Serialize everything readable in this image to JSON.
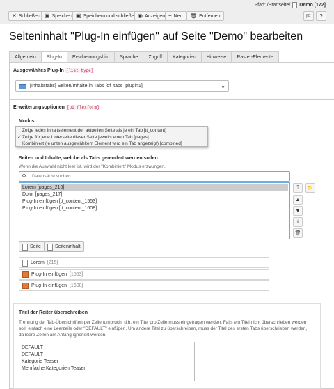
{
  "toolbar": {
    "close_label": "Schließen",
    "save_label": "Speichern",
    "save_close_label": "Speichern und schließen",
    "view_label": "Anzeigen",
    "new_label": "Neu",
    "delete_label": "Entfernen"
  },
  "path": {
    "prefix": "Pfad: /Startseite/",
    "page": "Demo [172]"
  },
  "page_title": "Seiteninhalt \"Plug-In einfügen\" auf Seite \"Demo\" bearbeiten",
  "tabs": [
    "Allgemein",
    "Plug-In",
    "Erscheinungsbild",
    "Sprache",
    "Zugriff",
    "Kategorien",
    "Hinweise",
    "Raster-Elemente"
  ],
  "active_tab": "Plug-In",
  "plugin": {
    "label": "Ausgewähltes Plug-In",
    "code": "[list_type]",
    "value": "[Inhaltstabs] Seiten/Inhalte in Tabs [df_tabs_plugin1]"
  },
  "options": {
    "label": "Erweiterungsoptionen",
    "code": "[pi_flexform]"
  },
  "modus": {
    "label": "Modus",
    "options": [
      "Zeige jedes Inhaltselement der aktuellen Seite als je ein Tab [tt_content]",
      "Zeige für jede Unterseite dieser Seite jeweils einen Tab [pages]",
      "Kombiniert (je unten ausgewähltem Element wird ein Tab angezeigt) [combined]"
    ],
    "checked_index": 1,
    "check_mark": "✓"
  },
  "records": {
    "title": "Seiten und Inhalte, welche als Tabs gerendert werden sollen",
    "help": "Wenn die Auswahl nicht leer ist, wird der \"Kombiniert\" Modus erzwungen.",
    "search_placeholder": "Datensätze suchen",
    "selected": [
      "Lorem [pages_215]",
      "Dolor [pages_217]",
      "Plug-In einfügen [tt_content_1553]",
      "Plug-In einfügen [tt_content_1608]"
    ],
    "add_page_label": "Seite",
    "add_content_label": "Seiteninhalt",
    "items": [
      {
        "name": "Lorem",
        "uid": "[215]",
        "kind": "page"
      },
      {
        "name": "Plug-In einfügen",
        "uid": "[1553]",
        "kind": "content"
      },
      {
        "name": "Plug-In einfügen",
        "uid": "[1608]",
        "kind": "content"
      }
    ]
  },
  "titles": {
    "label": "Titel der Reiter überschreiben",
    "help": "Trennung der Tab-Überschriften per Zeilenumbruch, d.h. ein Titel pro Zeile muss eingetragen werden. Falls ein Titel nicht überschrieben werden soll, einfach eine Leerzeile oder \"DEFAULT\" einfügen. Um andere Titel zu überschreiben, muss der Titel des ersten Tabs überschrieben werden, da leere Zeilen am Anfang ignoriert werden.",
    "lines": [
      "DEFAULT",
      "DEFAULT",
      "Kategorie Teaser",
      "Mehrfache Kategorien Teaser"
    ]
  }
}
